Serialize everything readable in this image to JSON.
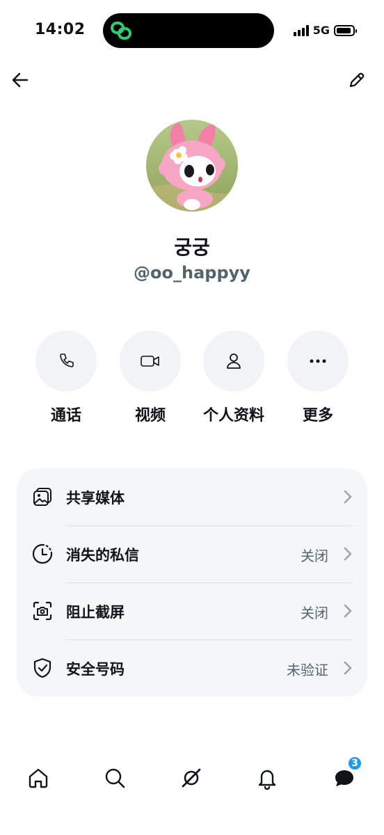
{
  "status_bar": {
    "time": "14:02",
    "network": "5G"
  },
  "profile": {
    "display_name": "궁궁",
    "handle": "@oo_happyy"
  },
  "actions": [
    {
      "label": "通话",
      "icon": "phone-icon"
    },
    {
      "label": "视频",
      "icon": "video-icon"
    },
    {
      "label": "个人资料",
      "icon": "person-icon"
    },
    {
      "label": "更多",
      "icon": "more-icon"
    }
  ],
  "settings": [
    {
      "label": "共享媒体",
      "value": "",
      "icon": "media-icon"
    },
    {
      "label": "消失的私信",
      "value": "关闭",
      "icon": "timer-icon"
    },
    {
      "label": "阻止截屏",
      "value": "关闭",
      "icon": "screenshot-icon"
    },
    {
      "label": "安全号码",
      "value": "未验证",
      "icon": "shield-check-icon"
    }
  ],
  "tabbar": {
    "messages_badge": "3"
  },
  "colors": {
    "accent": "#1d9bf0",
    "secondary_text": "#536471",
    "card_bg": "#f5f6f8",
    "action_circle_bg": "#f2f3f5"
  }
}
